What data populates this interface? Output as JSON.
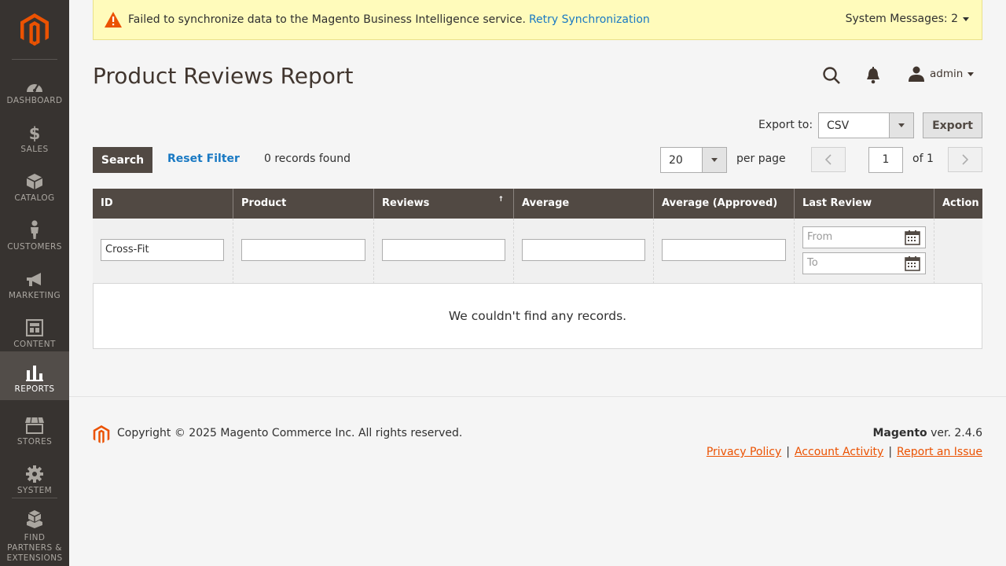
{
  "notice": {
    "message": "Failed to synchronize data to the Magento Business Intelligence service.",
    "link": "Retry Synchronization",
    "system_messages": "System Messages: 2"
  },
  "sidebar": {
    "items": [
      {
        "label": "DASHBOARD",
        "icon": "dashboard-icon"
      },
      {
        "label": "SALES",
        "icon": "dollar-icon"
      },
      {
        "label": "CATALOG",
        "icon": "box-icon"
      },
      {
        "label": "CUSTOMERS",
        "icon": "person-icon"
      },
      {
        "label": "MARKETING",
        "icon": "megaphone-icon"
      },
      {
        "label": "CONTENT",
        "icon": "layout-icon"
      },
      {
        "label": "REPORTS",
        "icon": "bar-chart-icon"
      },
      {
        "label": "STORES",
        "icon": "store-icon"
      },
      {
        "label": "SYSTEM",
        "icon": "gear-icon"
      },
      {
        "label_lines": [
          "FIND",
          "PARTNERS",
          "&",
          "EXTENSIONS"
        ],
        "icon": "boxes-icon"
      }
    ],
    "active": "REPORTS"
  },
  "header": {
    "title": "Product Reviews Report",
    "user": "admin"
  },
  "export": {
    "label": "Export to:",
    "format": "CSV",
    "button": "Export"
  },
  "actions": {
    "search": "Search",
    "reset": "Reset Filter",
    "records": "0 records found",
    "per_page_value": "20",
    "per_page_label": "per page",
    "page": "1",
    "of_pages": "of 1"
  },
  "table": {
    "columns": [
      "ID",
      "Product",
      "Reviews",
      "Average",
      "Average (Approved)",
      "Last Review",
      "Action"
    ],
    "filters": {
      "id": "Cross-Fit",
      "product": "",
      "reviews": "",
      "average": "",
      "average_approved": "",
      "from_placeholder": "From",
      "to_placeholder": "To"
    },
    "empty_message": "We couldn't find any records."
  },
  "footer": {
    "copyright": "Copyright © 2025 Magento Commerce Inc. All rights reserved.",
    "brand": "Magento",
    "version": " ver. 2.4.6",
    "links": [
      "Privacy Policy",
      "Account Activity",
      "Report an Issue"
    ],
    "sep": "|"
  },
  "colors": {
    "sidebar": "#373330",
    "accent": "#eb5202",
    "link": "#1979c3",
    "header_row": "#514943",
    "notice_bg": "#fffbbb"
  }
}
